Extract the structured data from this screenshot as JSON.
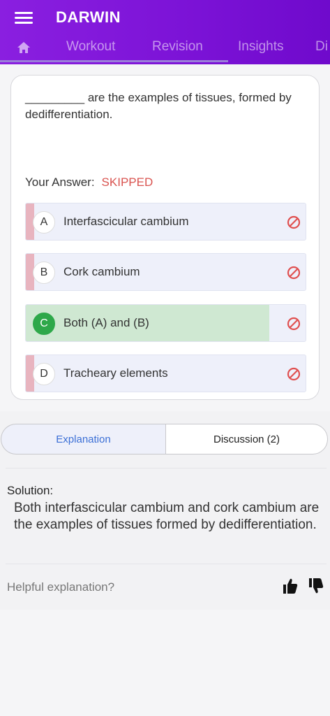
{
  "app": {
    "title": "DARWIN"
  },
  "tabs": [
    {
      "label": "Workout"
    },
    {
      "label": "Revision"
    },
    {
      "label": "Insights"
    },
    {
      "label": "Di"
    }
  ],
  "question": {
    "text": "_________ are the examples of tissues, formed by dedifferentiation.",
    "your_answer_label": "Your Answer:",
    "your_answer_status": "SKIPPED"
  },
  "options": [
    {
      "letter": "A",
      "text": "Interfascicular cambium",
      "state": "incorrect"
    },
    {
      "letter": "B",
      "text": "Cork cambium",
      "state": "incorrect"
    },
    {
      "letter": "C",
      "text": "Both (A) and (B)",
      "state": "correct"
    },
    {
      "letter": "D",
      "text": "Tracheary elements",
      "state": "incorrect"
    }
  ],
  "segments": {
    "explanation": "Explanation",
    "discussion": "Discussion (2)"
  },
  "solution": {
    "label": "Solution:",
    "text": "Both interfascicular cambium and cork cambium are the examples of tissues formed by dedifferentiation."
  },
  "feedback": {
    "prompt": "Helpful explanation?"
  },
  "colors": {
    "accent": "#7b12d6",
    "correct": "#2ea84a",
    "wrong": "#e8b4bf",
    "skipped": "#d9534f"
  }
}
